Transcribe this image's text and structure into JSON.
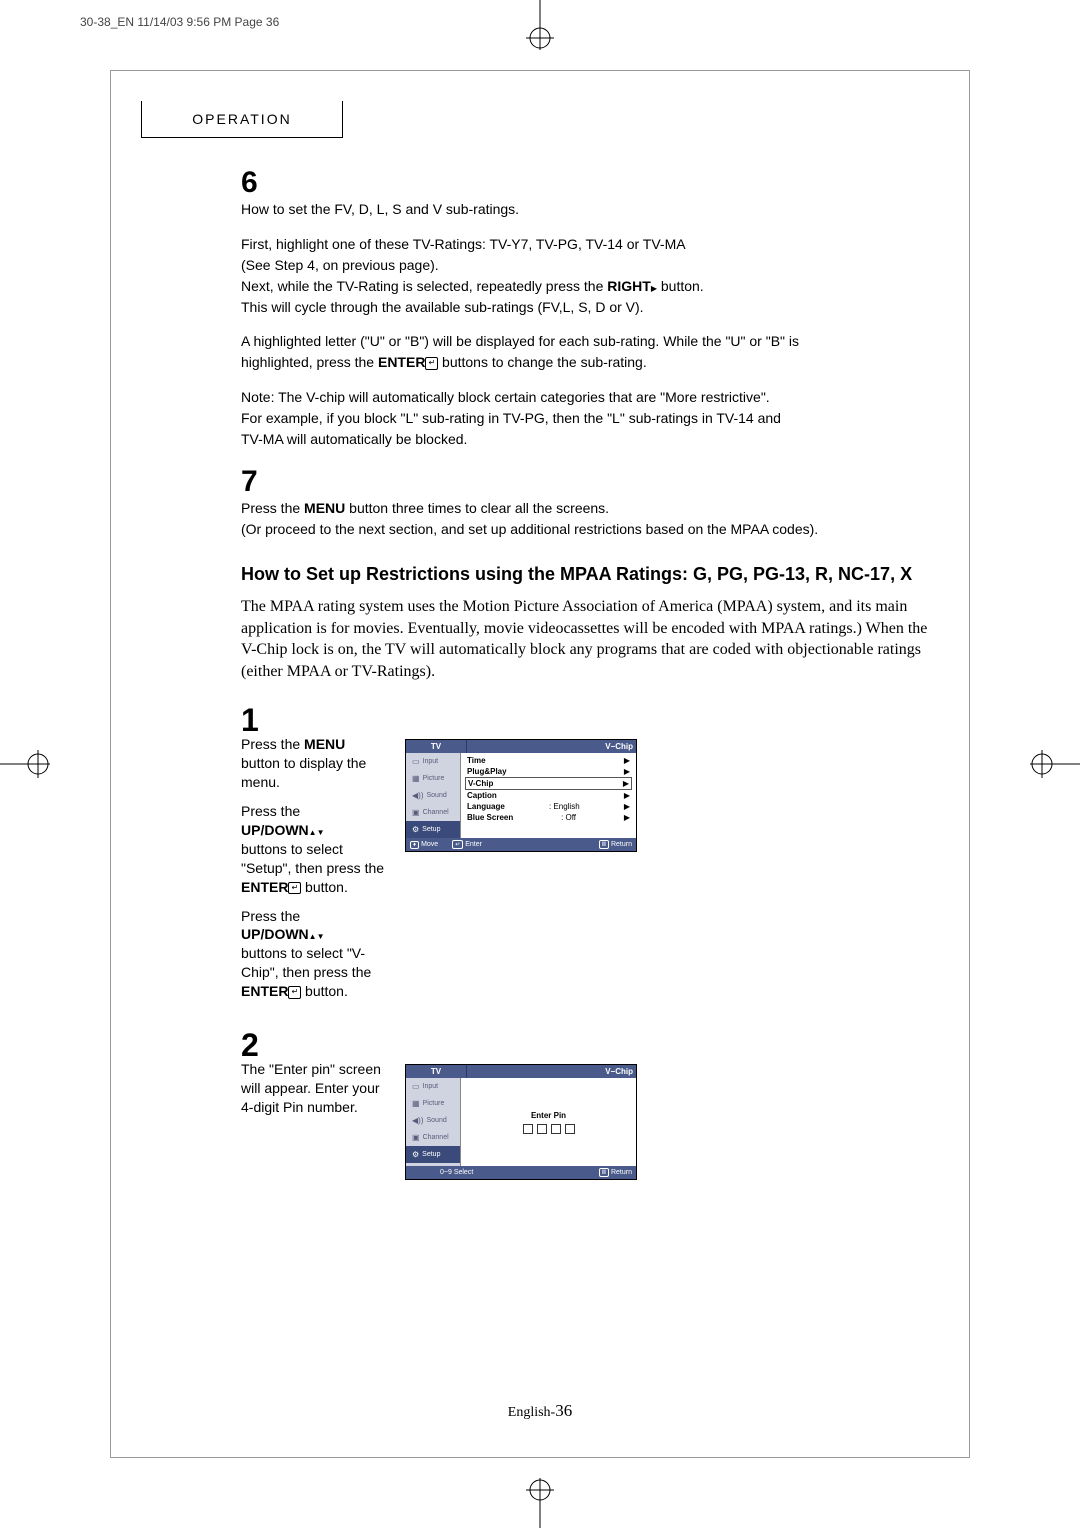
{
  "printer_header": "30-38_EN  11/14/03  9:56 PM  Page 36",
  "section_title": "OPERATION",
  "step6": {
    "num": "6",
    "line1": "How to set the FV, D, L, S and V sub-ratings.",
    "line2a": "First, highlight one of these TV-Ratings: TV-Y7, TV-PG, TV-14 or TV-MA",
    "line2b": "(See Step 4, on previous page).",
    "line3a": "Next, while the TV-Rating is selected, repeatedly press the ",
    "line3b": "RIGHT",
    "line3c": "  button.",
    "line4": "This will cycle through the available sub-ratings (FV,L, S, D or V).",
    "line5a": "A highlighted letter (\"U\" or \"B\") will be displayed for each sub-rating. While the \"U\" or \"B\" is",
    "line5b": "highlighted, press the ",
    "line5c": "ENTER",
    "line5d": "  buttons to change the sub-rating.",
    "note1": "Note: The V-chip will automatically block certain categories that are \"More restrictive\".",
    "note2": "For example, if you block \"L\" sub-rating in TV-PG, then the \"L\" sub-ratings in TV-14 and",
    "note3": "TV-MA will automatically be blocked."
  },
  "step7": {
    "num": "7",
    "line1a": "Press the ",
    "line1b": "MENU",
    "line1c": " button three times to clear all the screens.",
    "line2": "(Or proceed to the next section, and set up additional restrictions based on the MPAA codes)."
  },
  "mpaa_heading": "How to Set up Restrictions using the MPAA Ratings: G, PG, PG-13, R, NC-17, X",
  "mpaa_intro": "The MPAA rating system uses the Motion Picture Association of America (MPAA) system, and its main application is for movies. Eventually, movie videocassettes will be encoded with MPAA ratings.) When the V-Chip lock is on, the TV will automatically block any programs that are coded with objectionable ratings (either MPAA or TV-Ratings).",
  "step1": {
    "num": "1",
    "p1a": "Press the ",
    "p1b": "MENU",
    "p1c": " button to display the menu.",
    "p2a": "Press the",
    "p2b": "UP/DOWN",
    "p2c": " buttons to select \"Setup\", then press  the ",
    "p2d": "ENTER",
    "p2e": "  button.",
    "p3a": "Press the",
    "p3b": "UP/DOWN",
    "p3c": " buttons to select \"V-Chip\", then press the",
    "p3d": "ENTER",
    "p3e": "  button."
  },
  "step2": {
    "num": "2",
    "text": "The \"Enter pin\" screen will appear. Enter your 4-digit Pin number."
  },
  "tv1": {
    "title": "TV",
    "right": "V−Chip",
    "side": [
      "Input",
      "Picture",
      "Sound",
      "Channel",
      "Setup"
    ],
    "rows": [
      {
        "l": "Time",
        "r": "▶"
      },
      {
        "l": "Plug&Play",
        "r": "▶"
      },
      {
        "l": "V-Chip",
        "r": "▶",
        "sel": true
      },
      {
        "l": "Caption",
        "r": "▶"
      },
      {
        "l": "Language",
        "m": ":   English",
        "r": "▶"
      },
      {
        "l": "Blue Screen",
        "m": ":   Off",
        "r": "▶"
      }
    ],
    "foot": {
      "move": "Move",
      "enter": "Enter",
      "return": "Return"
    }
  },
  "tv2": {
    "title": "TV",
    "right": "V−Chip",
    "side": [
      "Input",
      "Picture",
      "Sound",
      "Channel",
      "Setup"
    ],
    "enter_pin": "Enter Pin",
    "foot": {
      "select": "0~9 Select",
      "return": "Return"
    }
  },
  "page_number_label": "English-",
  "page_number": "36"
}
